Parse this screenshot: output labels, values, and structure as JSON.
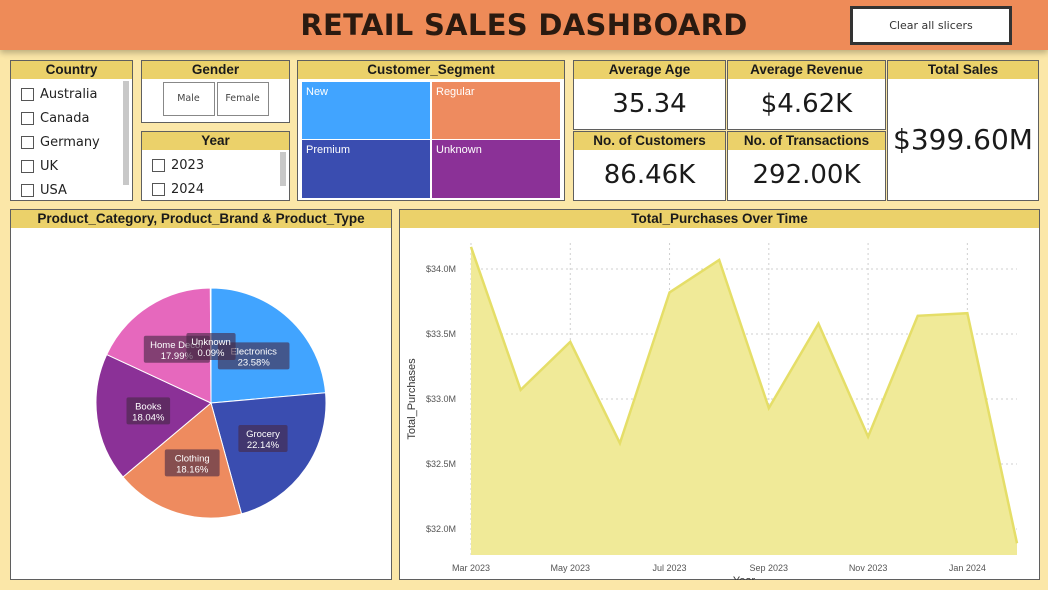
{
  "header": {
    "title": "RETAIL SALES DASHBOARD",
    "clear_label": "Clear all slicers"
  },
  "country": {
    "title": "Country",
    "items": [
      "Australia",
      "Canada",
      "Germany",
      "UK",
      "USA"
    ]
  },
  "gender": {
    "title": "Gender",
    "options": [
      "Male",
      "Female"
    ]
  },
  "year": {
    "title": "Year",
    "items": [
      "2023",
      "2024"
    ]
  },
  "segment": {
    "title": "Customer_Segment",
    "tiles": [
      {
        "label": "New",
        "color": "#41A4FF"
      },
      {
        "label": "Regular",
        "color": "#EE8B5F"
      },
      {
        "label": "Premium",
        "color": "#3A4DB0"
      },
      {
        "label": "Unknown",
        "color": "#8B3197"
      }
    ]
  },
  "kpis": {
    "avg_age": {
      "label": "Average Age",
      "value": "35.34"
    },
    "avg_revenue": {
      "label": "Average Revenue",
      "value": "$4.62K"
    },
    "total_sales": {
      "label": "Total Sales",
      "value": "$399.60M"
    },
    "customers": {
      "label": "No. of Customers",
      "value": "86.46K"
    },
    "transactions": {
      "label": "No. of Transactions",
      "value": "292.00K"
    }
  },
  "chart_data": [
    {
      "type": "pie",
      "title": "Product_Category, Product_Brand & Product_Type",
      "slices": [
        {
          "label": "Electronics",
          "value": 23.58,
          "display": "23.58%",
          "color": "#41A4FF"
        },
        {
          "label": "Grocery",
          "value": 22.14,
          "display": "22.14%",
          "color": "#3A4DB0"
        },
        {
          "label": "Clothing",
          "value": 18.16,
          "display": "18.16%",
          "color": "#EE8B5F"
        },
        {
          "label": "Books",
          "value": 18.04,
          "display": "18.04%",
          "color": "#8B3197"
        },
        {
          "label": "Home Decor",
          "value": 17.99,
          "display": "17.99%",
          "color": "#E668BD"
        },
        {
          "label": "Unknown",
          "value": 0.09,
          "display": "0.09%",
          "color": "#F2C84B"
        }
      ]
    },
    {
      "type": "area",
      "title": "Total_Purchases Over Time",
      "xlabel": "Year",
      "ylabel": "Total_Purchases",
      "x": [
        "2023-03",
        "2023-04",
        "2023-05",
        "2023-06",
        "2023-07",
        "2023-08",
        "2023-09",
        "2023-10",
        "2023-11",
        "2023-12",
        "2024-01",
        "2024-02"
      ],
      "values": [
        34.17,
        33.07,
        33.44,
        32.66,
        33.82,
        34.07,
        32.93,
        33.58,
        32.71,
        33.64,
        33.66,
        31.89
      ],
      "ylim": [
        31.8,
        34.2
      ],
      "yticks": [
        32.0,
        32.5,
        33.0,
        33.5,
        34.0
      ],
      "ytick_labels": [
        "$32.0M",
        "$32.5M",
        "$33.0M",
        "$33.5M",
        "$34.0M"
      ],
      "xtick_labels": [
        {
          "x": "2023-03",
          "label": "Mar 2023"
        },
        {
          "x": "2023-05",
          "label": "May 2023"
        },
        {
          "x": "2023-07",
          "label": "Jul 2023"
        },
        {
          "x": "2023-09",
          "label": "Sep 2023"
        },
        {
          "x": "2023-11",
          "label": "Nov 2023"
        },
        {
          "x": "2024-01",
          "label": "Jan 2024"
        }
      ],
      "fill_color": "#F0EA98",
      "line_color": "#E5DE68",
      "grid": true
    }
  ]
}
